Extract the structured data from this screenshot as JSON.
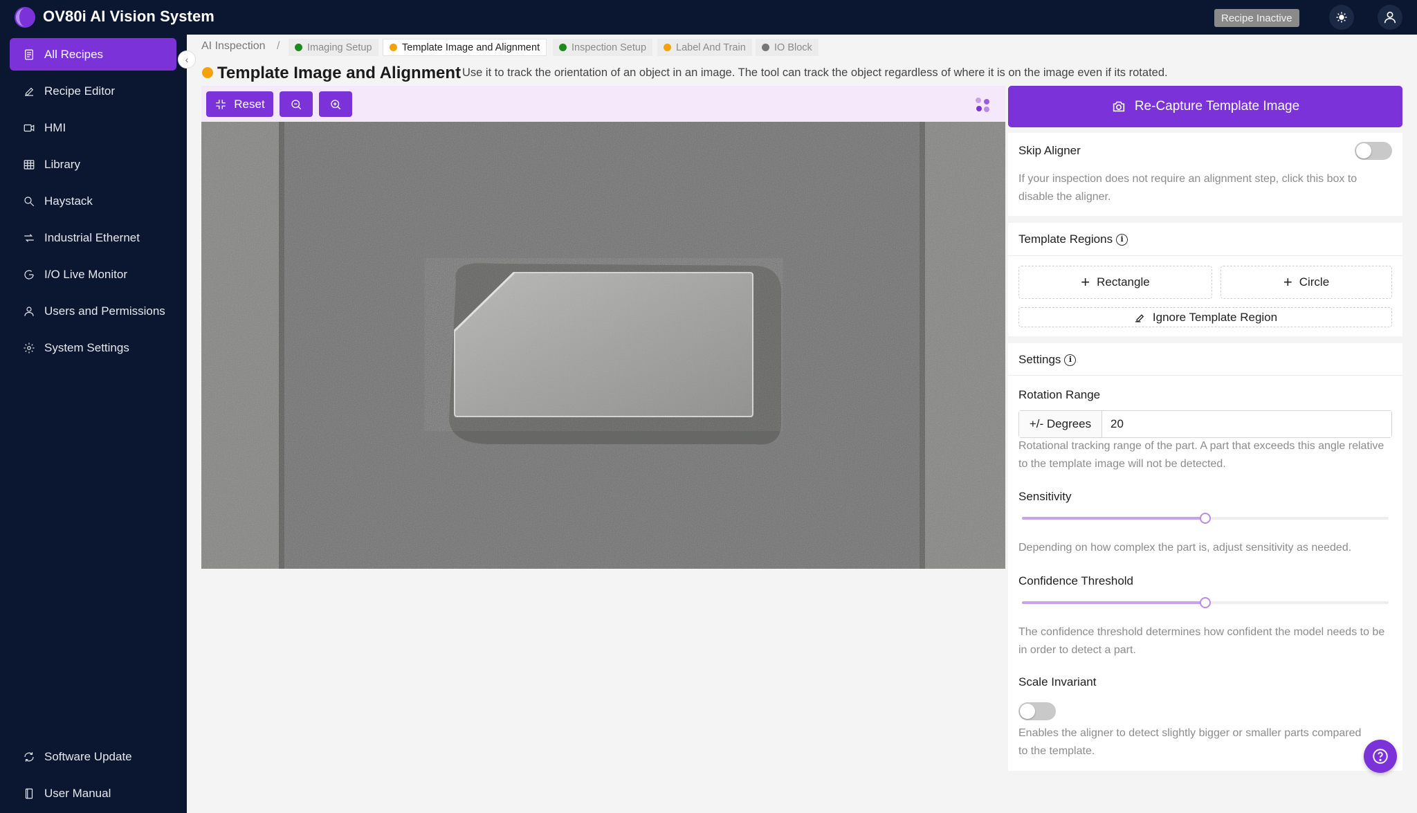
{
  "app": {
    "title": "OV80i AI Vision System",
    "status_badge": "Recipe Inactive"
  },
  "sidebar": {
    "items": [
      {
        "label": "All Recipes",
        "icon": "document-icon",
        "active": true
      },
      {
        "label": "Recipe Editor",
        "icon": "pencil-icon"
      },
      {
        "label": "HMI",
        "icon": "video-icon"
      },
      {
        "label": "Library",
        "icon": "grid-icon"
      },
      {
        "label": "Haystack",
        "icon": "search-icon"
      },
      {
        "label": "Industrial Ethernet",
        "icon": "network-icon"
      },
      {
        "label": "I/O Live Monitor",
        "icon": "gauge-icon"
      },
      {
        "label": "Users and Permissions",
        "icon": "user-icon"
      },
      {
        "label": "System Settings",
        "icon": "gear-icon"
      }
    ],
    "bottom": [
      {
        "label": "Software Update",
        "icon": "refresh-icon"
      },
      {
        "label": "User Manual",
        "icon": "book-icon"
      }
    ]
  },
  "breadcrumb": {
    "root": "AI Inspection",
    "separator": "/",
    "steps": [
      {
        "label": "Imaging Setup",
        "status_color": "#1e8a1e"
      },
      {
        "label": "Template Image and Alignment",
        "status_color": "#f5a20a",
        "current": true
      },
      {
        "label": "Inspection Setup",
        "status_color": "#1e8a1e"
      },
      {
        "label": "Label And Train",
        "status_color": "#f5a20a"
      },
      {
        "label": "IO Block",
        "status_color": "#777777"
      }
    ]
  },
  "page": {
    "title": "Template Image and Alignment",
    "status_color": "#f5a20a",
    "description": "Use it to track the orientation of an object in an image. The tool can track the object regardless of where it is on the image even if its rotated."
  },
  "toolbar": {
    "reset_label": "Reset",
    "zoom_out_icon": "zoom-out-icon",
    "zoom_in_icon": "zoom-in-icon"
  },
  "panel": {
    "recapture_label": "Re-Capture Template Image",
    "skip_aligner": {
      "label": "Skip Aligner",
      "enabled": false,
      "help": "If your inspection does not require an alignment step, click this box to disable the aligner."
    },
    "template_regions": {
      "title": "Template Regions",
      "rectangle_label": "Rectangle",
      "circle_label": "Circle",
      "ignore_label": "Ignore Template Region"
    },
    "settings": {
      "title": "Settings",
      "rotation": {
        "label": "Rotation Range",
        "unit_label": "+/- Degrees",
        "value": "20",
        "help": "Rotational tracking range of the part. A part that exceeds this angle relative to the template image will not be detected."
      },
      "sensitivity": {
        "label": "Sensitivity",
        "value_fraction": 0.5,
        "help": "Depending on how complex the part is, adjust sensitivity as needed."
      },
      "confidence": {
        "label": "Confidence Threshold",
        "value_fraction": 0.5,
        "help": "The confidence threshold determines how confident the model needs to be in order to detect a part."
      },
      "scale_invariant": {
        "label": "Scale Invariant",
        "enabled": false,
        "help": "Enables the aligner to detect slightly bigger or smaller parts compared to the template."
      }
    }
  },
  "colors": {
    "accent": "#7b33d9",
    "nav_bg": "#0b1730"
  }
}
